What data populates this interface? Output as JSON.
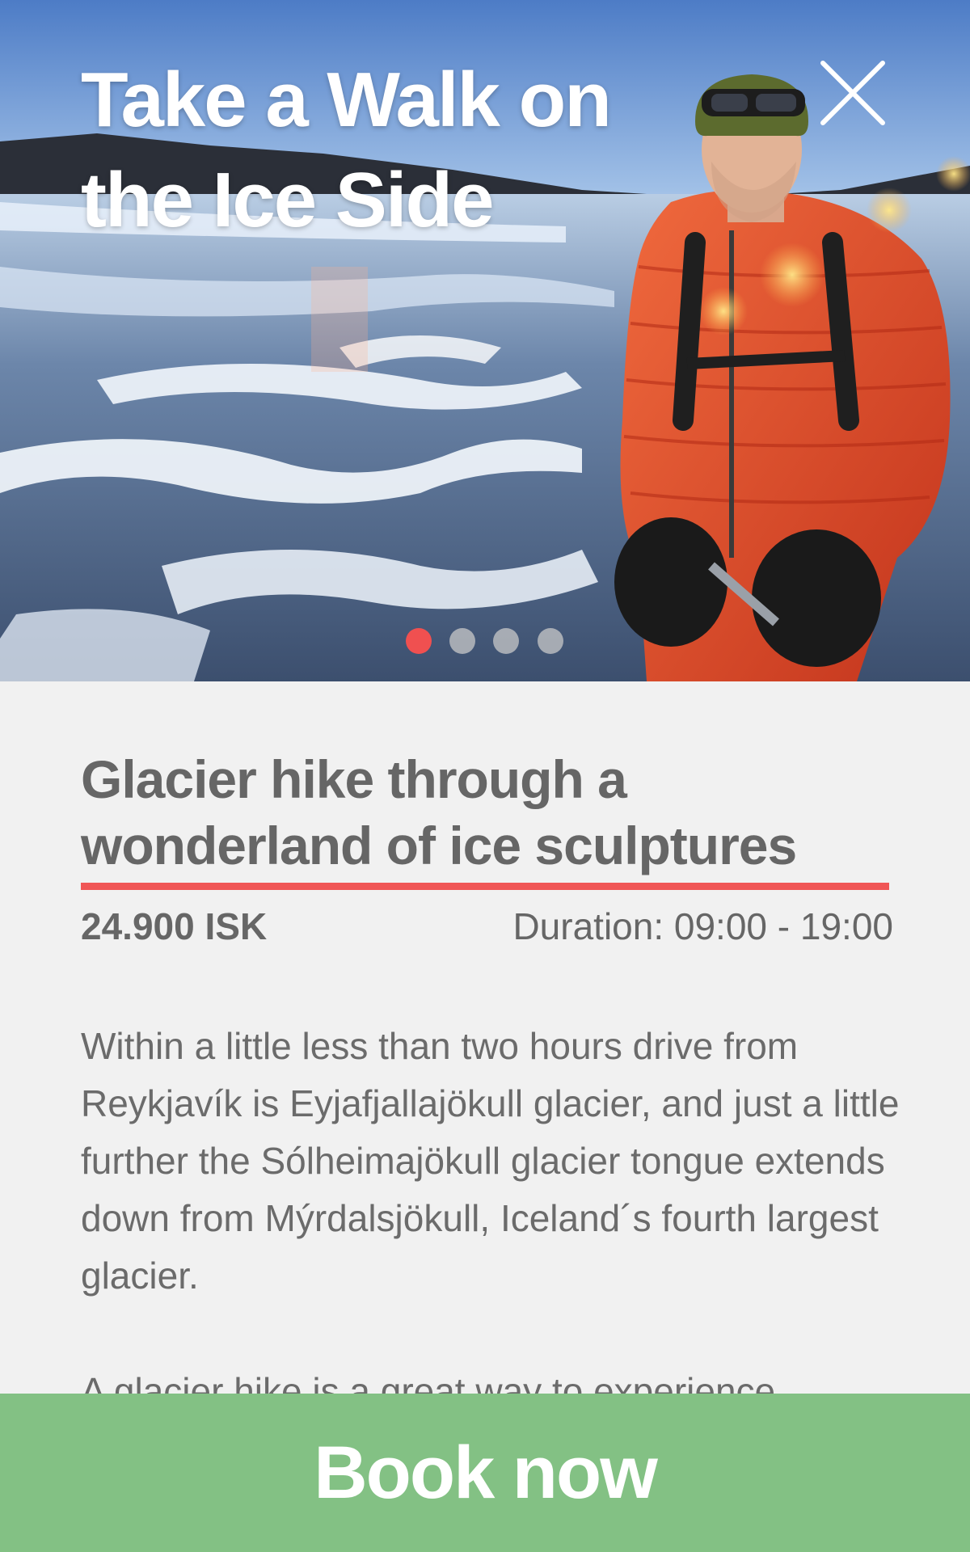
{
  "hero": {
    "title": "Take a Walk on the Ice Side",
    "close_icon": "close-icon",
    "photo_subject": "hiker-on-glacier-image",
    "carousel": {
      "count": 4,
      "active_index": 0
    }
  },
  "tour": {
    "title": "Glacier hike through a wonderland of ice sculptures",
    "price": "24.900 ISK",
    "duration": "Duration: 09:00 - 19:00",
    "description": [
      "Within a little less than two hours drive from Reykjavík is Eyjafjallajökull glacier, and just a little further the Sólheimajökull glacier tongue extends down from Mýrdalsjökull, Iceland´s fourth largest glacier.",
      "A glacier hike is a great way to experience"
    ]
  },
  "cta": {
    "book_label": "Book now"
  },
  "colors": {
    "accent_red": "#f05656",
    "book_green": "#83c184",
    "text_gray": "#666666",
    "background": "#f1f1f1"
  }
}
